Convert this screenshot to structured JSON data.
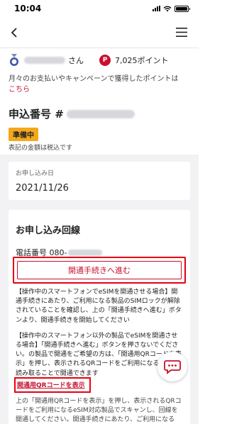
{
  "status_bar": {
    "time": "10:04"
  },
  "header": {
    "back_icon": "chevron-left-icon",
    "menu_icon": "hamburger-menu-icon"
  },
  "user": {
    "name_suffix": "さん",
    "points": "7,025ポイント",
    "point_icon_letter": "P"
  },
  "points_info": {
    "text": "月々のお支払いやキャンペーンで獲得したポイントは",
    "link": "こちら"
  },
  "order": {
    "title": "申込番号 #",
    "status": "準備中",
    "tax_note": "表記の金額は税込です",
    "date_label": "お申し込み日",
    "date_value": "2021/11/26"
  },
  "line": {
    "title": "お申し込み回線",
    "phone_label": "電話番号 080-",
    "activate_button": "開通手続きへ進む",
    "instructions": [
      "【操作中のスマートフォンでeSIMを開通させる場合】開通手続きにあたり、ご利用になる製品のSIMロックが解除されていることを確認し、上の「開通手続きへ進む」ボタンより、開通手続きを開始してください",
      "【操作中のスマートフォン以外の製品でeSIMを開通させる場合】「開通手続きへ進む」ボタンを押さないでください。の製品で開通をご希望の方は、「開通用QRコードを表示」を押し、表示されるQRコードをご利用になる製品で読み取ることで開通できます"
    ],
    "qr_link": "開通用QRコードを表示",
    "bottom_text": "上の「開通用QRコードを表示」を押し、表示されるQRコードをご利用になるeSIM対応製品でスキャンし、回線を開通してください。開通手続きにあたり、ご利用になる"
  },
  "colors": {
    "accent": "#c8102e",
    "highlight": "#e60012",
    "status_chip": "#f4a81d"
  }
}
